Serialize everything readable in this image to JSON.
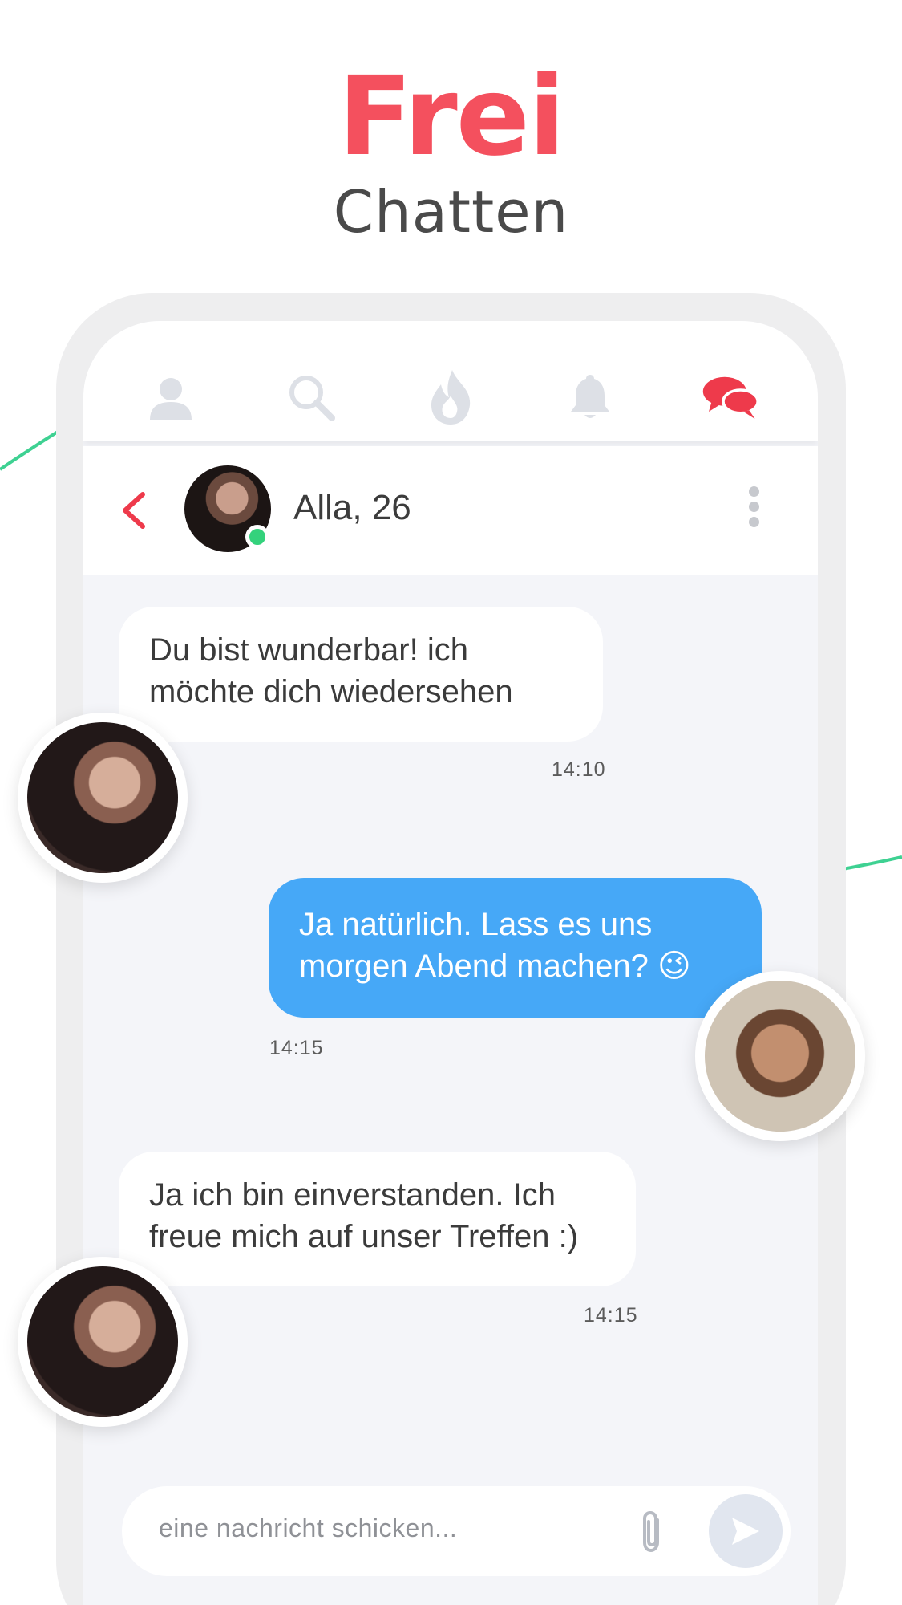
{
  "hero": {
    "title": "Frei",
    "subtitle": "Chatten",
    "title_color": "#f4505e"
  },
  "nav": {
    "items": [
      {
        "icon": "profile-icon",
        "active": false
      },
      {
        "icon": "search-icon",
        "active": false
      },
      {
        "icon": "flame-icon",
        "active": false
      },
      {
        "icon": "bell-icon",
        "active": false
      },
      {
        "icon": "chat-bubbles-icon",
        "active": true
      }
    ],
    "active_color": "#ee3a4b",
    "inactive_color": "#dde0e6"
  },
  "chat_header": {
    "name": "Alla, 26",
    "online": true,
    "online_color": "#34d27c"
  },
  "messages": [
    {
      "direction": "in",
      "text_line1": "Du bist wunderbar! ich",
      "text_line2": "möchte dich wiedersehen",
      "time": "14:10"
    },
    {
      "direction": "out",
      "text_line1": "Ja natürlich. Lass es uns",
      "text_line2": "morgen Abend machen? 😉",
      "time": "14:15"
    },
    {
      "direction": "in",
      "text_line1": "Ja ich bin einverstanden. Ich",
      "text_line2": "freue mich auf unser Treffen :)",
      "time": "14:15"
    }
  ],
  "composer": {
    "placeholder": "eine nachricht schicken..."
  },
  "colors": {
    "outgoing_bubble": "#46a8f7",
    "incoming_bubble": "#ffffff",
    "chat_background": "#f4f5f9",
    "accent_green": "#3ed192"
  }
}
